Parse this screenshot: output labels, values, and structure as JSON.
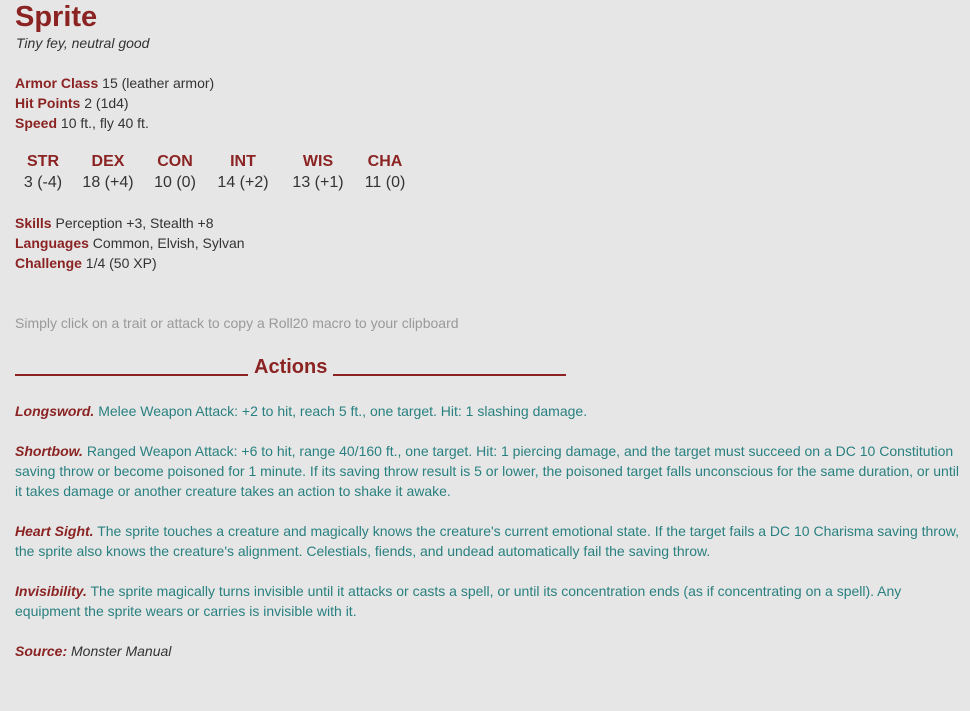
{
  "monster": {
    "name": "Sprite",
    "subtitle": "Tiny fey, neutral good"
  },
  "props": {
    "armor_class": {
      "label": "Armor Class",
      "value": "15 (leather armor)"
    },
    "hit_points": {
      "label": "Hit Points",
      "value": "2 (1d4)"
    },
    "speed": {
      "label": "Speed",
      "value": "10 ft., fly 40 ft."
    },
    "skills": {
      "label": "Skills",
      "value": "Perception +3, Stealth +8"
    },
    "languages": {
      "label": "Languages",
      "value": "Common, Elvish, Sylvan"
    },
    "challenge": {
      "label": "Challenge",
      "value": "1/4 (50 XP)"
    }
  },
  "abilities": [
    {
      "name": "STR",
      "value": "3 (-4)"
    },
    {
      "name": "DEX",
      "value": "18 (+4)"
    },
    {
      "name": "CON",
      "value": "10 (0)"
    },
    {
      "name": "INT",
      "value": "14 (+2)"
    },
    {
      "name": "WIS",
      "value": "13 (+1)"
    },
    {
      "name": "CHA",
      "value": "11 (0)"
    }
  ],
  "hint": "Simply click on a trait or attack to copy a Roll20 macro to your clipboard",
  "actions_heading": "Actions",
  "actions": [
    {
      "name": "Longsword.",
      "text": "Melee Weapon Attack: +2 to hit, reach 5 ft., one target. Hit: 1 slashing damage."
    },
    {
      "name": "Shortbow.",
      "text": "Ranged Weapon Attack: +6 to hit, range 40/160 ft., one target. Hit: 1 piercing damage, and the target must succeed on a DC 10 Constitution saving throw or become poisoned for 1 minute. If its saving throw result is 5 or lower, the poisoned target falls unconscious for the same duration, or until it takes damage or another creature takes an action to shake it awake."
    },
    {
      "name": "Heart Sight.",
      "text": "The sprite touches a creature and magically knows the creature's current emotional state. If the target fails a DC 10 Charisma saving throw, the sprite also knows the creature's alignment. Celestials, fiends, and undead automatically fail the saving throw."
    },
    {
      "name": "Invisibility.",
      "text": "The sprite magically turns invisible until it attacks or casts a spell, or until its concentration ends (as if concentrating on a spell). Any equipment the sprite wears or carries is invisible with it."
    }
  ],
  "source": {
    "label": "Source:",
    "value": "Monster Manual"
  },
  "colors": {
    "accent": "#8b2323",
    "action_text": "#2a8080",
    "hint": "#999999",
    "background": "#e6e6e6"
  }
}
